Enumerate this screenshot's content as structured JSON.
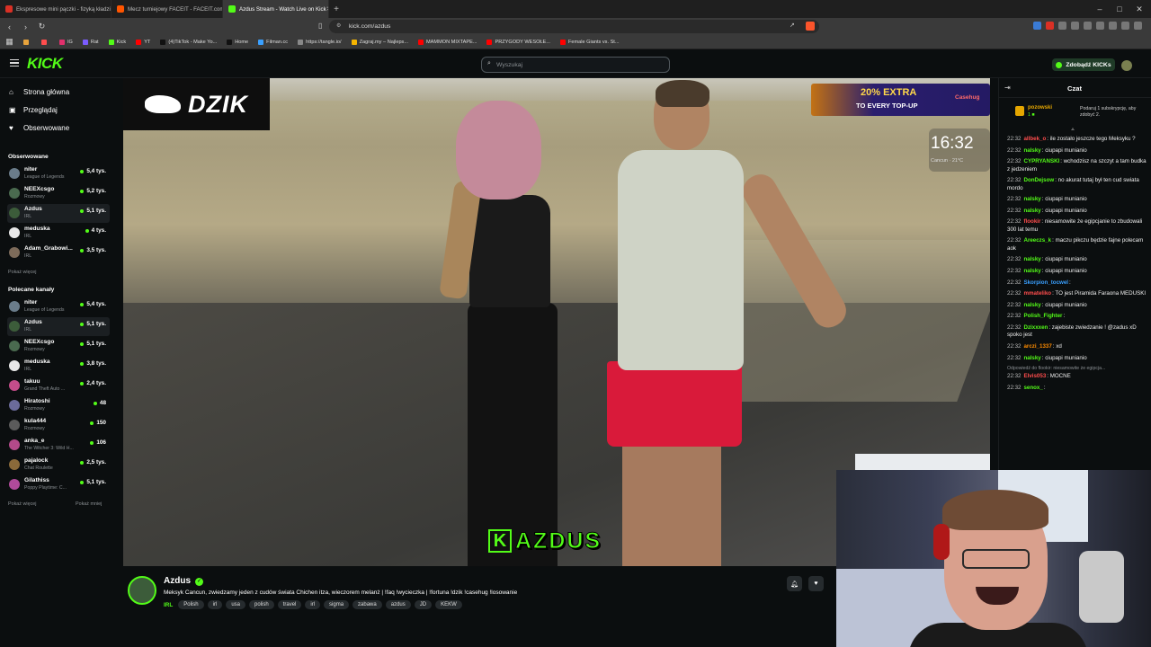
{
  "browser": {
    "tabs": [
      {
        "label": "Ekspresowe mini pączki - fizyką kładzie",
        "color": "#d93025"
      },
      {
        "label": "Mecz turniejowy FACEIT - FACEIT.com",
        "color": "#ff5500"
      },
      {
        "label": "Azdus Stream - Watch Live on Kick",
        "color": "#53fc18",
        "active": true
      }
    ],
    "url": "kick.com/azdus",
    "bookmarks": [
      {
        "label": "IG",
        "color": "#e1306c"
      },
      {
        "label": "Rat",
        "color": "#7b5cff"
      },
      {
        "label": "Kick",
        "color": "#53fc18"
      },
      {
        "label": "YT",
        "color": "#ff0000"
      },
      {
        "label": "(4)TikTok - Make Yo...",
        "color": "#111111"
      },
      {
        "label": "Home",
        "color": "#111111"
      },
      {
        "label": "Filman.cc",
        "color": "#3aa0ff"
      },
      {
        "label": "https://tangle.io/",
        "color": "#888888"
      },
      {
        "label": "Zagraj.my – Najleps...",
        "color": "#f5b400"
      },
      {
        "label": "MAMMON MIXTAPE...",
        "color": "#ff0000"
      },
      {
        "label": "PRZYGODY WESOŁE...",
        "color": "#ff0000"
      },
      {
        "label": "Female Giants vs. St...",
        "color": "#ff0000"
      }
    ]
  },
  "header": {
    "logo": "KICK",
    "search_placeholder": "Wyszukaj",
    "kicks_button": "Zdobądź KICKs"
  },
  "sidebar": {
    "nav": [
      {
        "label": "Strona główna",
        "icon": "home-icon",
        "glyph": "⌂"
      },
      {
        "label": "Przeglądaj",
        "icon": "browse-icon",
        "glyph": "▣"
      },
      {
        "label": "Obserwowane",
        "icon": "heart-icon",
        "glyph": "♥"
      }
    ],
    "followed_title": "Obserwowane",
    "followed": [
      {
        "name": "niter",
        "category": "League of Legends",
        "viewers": "5,4 tys.",
        "color": "#6a7c8a"
      },
      {
        "name": "NEEXcsgo",
        "category": "Rozmowy",
        "viewers": "5,2 tys.",
        "color": "#4a6a4f"
      },
      {
        "name": "Azdus",
        "category": "IRL",
        "viewers": "5,1 tys.",
        "color": "#3c5c3a",
        "active": true
      },
      {
        "name": "meduska",
        "category": "IRL",
        "viewers": "4 tys.",
        "color": "#e8e8e8"
      },
      {
        "name": "Adam_Grabowi...",
        "category": "IRL",
        "viewers": "3,5 tys.",
        "color": "#7d6b5a"
      }
    ],
    "followed_more": "Pokaż więcej",
    "recommended_title": "Polecane kanały",
    "recommended": [
      {
        "name": "niter",
        "category": "League of Legends",
        "viewers": "5,4 tys.",
        "color": "#6a7c8a"
      },
      {
        "name": "Azdus",
        "category": "IRL",
        "viewers": "5,1 tys.",
        "color": "#3c5c3a",
        "active": true
      },
      {
        "name": "NEEXcsgo",
        "category": "Rozmowy",
        "viewers": "5,1 tys.",
        "color": "#4a6a4f"
      },
      {
        "name": "meduska",
        "category": "IRL",
        "viewers": "3,8 tys.",
        "color": "#e8e8e8"
      },
      {
        "name": "takuu",
        "category": "Grand Theft Auto ...",
        "viewers": "2,4 tys.",
        "color": "#c44d8a"
      },
      {
        "name": "Hiratoshi",
        "category": "Rozmowy",
        "viewers": "48",
        "color": "#6b6b9a"
      },
      {
        "name": "kula444",
        "category": "Rozmowy",
        "viewers": "150",
        "color": "#5b5b5b"
      },
      {
        "name": "anka_e",
        "category": "The Witcher 3: Wild H...",
        "viewers": "106",
        "color": "#b34a8a"
      },
      {
        "name": "pajalock",
        "category": "Chat Roulette",
        "viewers": "2,5 tys.",
        "color": "#8a6a3a"
      },
      {
        "name": "Gilathiss",
        "category": "Poppy Playtime: C...",
        "viewers": "5,1 tys.",
        "color": "#b04a9a"
      }
    ],
    "rec_more": "Pokaż więcej",
    "rec_less": "Pokaż mniej"
  },
  "video": {
    "overlay_brand": "DZIK",
    "promo_big": "20% EXTRA",
    "promo_small": "TO EVERY TOP-UP",
    "promo_brand": "Casehug",
    "clock": "16:32",
    "clock_sub": "Cancun · 21°C",
    "bottom_text": "AZDUS",
    "bottom_k": "K"
  },
  "stream": {
    "name": "Azdus",
    "title": "Meksyk Cancun, zwiedzamy jeden z cudów świata Chichen itza, wieczorem melanż | !faq !wycieczka | !fortuna !dzik !casehug !losowanie",
    "category": "IRL",
    "tags": [
      "Polish",
      "irl",
      "usa",
      "polish",
      "travel",
      "irl",
      "sigma",
      "zabawa",
      "azdus",
      "JD",
      "KEKW"
    ]
  },
  "chat": {
    "title": "Czat",
    "pinned_user": "pozowski",
    "pinned_sub": "1 ■",
    "pinned_text": "Podaruj 1 subskrypcję, aby zdobyć 2.",
    "messages": [
      {
        "time": "22:32",
        "user": "allbek_o",
        "color": "#ff4d4d",
        "text": "ile zostało jeszcze tego Meksyku ?"
      },
      {
        "time": "22:32",
        "user": "nalsky",
        "color": "#53fc18",
        "text": "ciupapi munianio"
      },
      {
        "time": "22:32",
        "user": "CYPRYANSKI",
        "color": "#53fc18",
        "text": "wchodzisz na szczyt a tam budka z jedzeniem"
      },
      {
        "time": "22:32",
        "user": "DonDejsow",
        "color": "#53fc18",
        "text": "no akurat tutaj był ten cud swiata mordo"
      },
      {
        "time": "22:32",
        "user": "nalsky",
        "color": "#53fc18",
        "text": "ciupapi munianio"
      },
      {
        "time": "22:32",
        "user": "nalsky",
        "color": "#53fc18",
        "text": "ciupapi munianio"
      },
      {
        "time": "22:32",
        "user": "flookir",
        "color": "#ff4d4d",
        "text": "niesamowite że egipcjanie to zbudowali 300 lat temu"
      },
      {
        "time": "22:32",
        "user": "Areeczs_k",
        "color": "#53fc18",
        "text": "maczu pikczu będzie fajne polecam aok"
      },
      {
        "time": "22:32",
        "user": "nalsky",
        "color": "#53fc18",
        "text": "ciupapi munianio"
      },
      {
        "time": "22:32",
        "user": "nalsky",
        "color": "#53fc18",
        "text": "ciupapi munianio"
      },
      {
        "time": "22:32",
        "user": "Skorpion_tocwel",
        "color": "#3aa0ff",
        "text": ""
      },
      {
        "time": "22:32",
        "user": "mmateliko",
        "color": "#ff4d4d",
        "text": "TO jest Piramida Faraona MEDUSKI"
      },
      {
        "time": "22:32",
        "user": "nalsky",
        "color": "#53fc18",
        "text": "ciupapi munianio"
      },
      {
        "time": "22:32",
        "user": "Polish_Fighter",
        "color": "#53fc18",
        "text": ""
      },
      {
        "time": "22:32",
        "user": "Dzixxxen",
        "color": "#53fc18",
        "text": "zajebiste zwiedzanie ! @zadus xD spoko jest"
      },
      {
        "time": "22:32",
        "user": "arczi_1337",
        "color": "#ff8c00",
        "text": "xd"
      },
      {
        "time": "22:32",
        "user": "nalsky",
        "color": "#53fc18",
        "text": "ciupapi munianio"
      },
      {
        "time": "22:32",
        "user": "Elvis053",
        "color": "#ff4d4d",
        "text": "MOCNE",
        "reply": "Odpowiedź do flookir: niesamowite że egipcja..."
      },
      {
        "time": "22:32",
        "user": "senox_",
        "color": "#53fc18",
        "text": ""
      }
    ]
  }
}
